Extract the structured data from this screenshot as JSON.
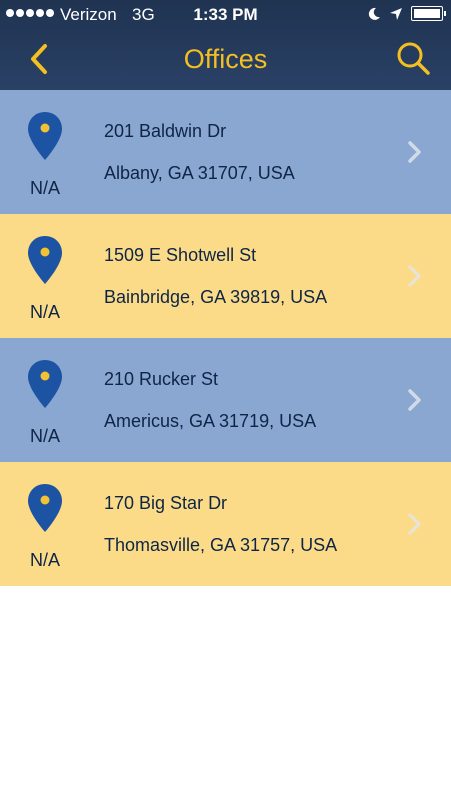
{
  "status_bar": {
    "carrier": "Verizon",
    "network": "3G",
    "time": "1:33 PM"
  },
  "nav": {
    "title": "Offices",
    "back_icon": "chevron-left-icon",
    "search_icon": "search-icon",
    "accent_color": "#f3bf22"
  },
  "offices": [
    {
      "street": "201 Baldwin Dr",
      "city": "Albany, GA 31707, USA",
      "distance": "N/A",
      "row_color": "#8aa7d1"
    },
    {
      "street": "1509 E Shotwell St",
      "city": "Bainbridge, GA 39819, USA",
      "distance": "N/A",
      "row_color": "#fbdb88"
    },
    {
      "street": "210 Rucker St",
      "city": "Americus, GA 31719, USA",
      "distance": "N/A",
      "row_color": "#8aa7d1"
    },
    {
      "street": "170 Big Star Dr",
      "city": "Thomasville, GA 31757, USA",
      "distance": "N/A",
      "row_color": "#fbdb88"
    }
  ]
}
